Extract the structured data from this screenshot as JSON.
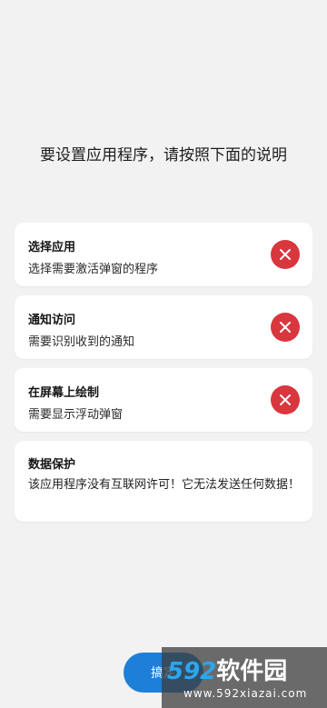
{
  "instruction": "要设置应用程序，请按照下面的说明",
  "permissions": [
    {
      "title": "选择应用",
      "desc": "选择需要激活弹窗的程序",
      "status": "not-granted"
    },
    {
      "title": "通知访问",
      "desc": "需要识别收到的通知",
      "status": "not-granted"
    },
    {
      "title": "在屏幕上绘制",
      "desc": "需要显示浮动弹窗",
      "status": "not-granted"
    }
  ],
  "data_card": {
    "title": "数据保护",
    "desc": "该应用程序没有互联网许可！它无法发送任何数据！"
  },
  "done_button": {
    "label": "搞定"
  },
  "watermark": {
    "number": "592",
    "name": "软件园",
    "url": "www.592xiazai.com"
  },
  "colors": {
    "error": "#d9363e",
    "primary": "#1e7fd8",
    "background": "#f2f2f2"
  }
}
